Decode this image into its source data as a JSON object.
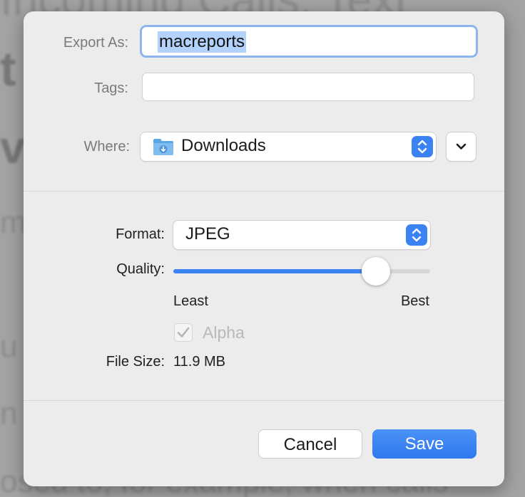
{
  "background": {
    "lines": [
      "Incoming Calls, Text",
      "t ?",
      "v",
      "m",
      "u  bl",
      "n c",
      "osed to, for example, when calls"
    ]
  },
  "dialog": {
    "export_as": {
      "label": "Export As:",
      "value": "macreports"
    },
    "tags": {
      "label": "Tags:",
      "value": ""
    },
    "where": {
      "label": "Where:",
      "value": "Downloads"
    },
    "format": {
      "label": "Format:",
      "value": "JPEG"
    },
    "quality": {
      "label": "Quality:",
      "level": 0.79,
      "min_label": "Least",
      "max_label": "Best"
    },
    "alpha": {
      "label": "Alpha",
      "checked": true,
      "enabled": false
    },
    "file_size": {
      "label": "File Size:",
      "value": "11.9 MB"
    },
    "buttons": {
      "cancel": "Cancel",
      "save": "Save"
    }
  },
  "colors": {
    "accent": "#3b83f2",
    "selection": "#b3d2fb",
    "focus_ring": "#8db4ee",
    "sheet_bg": "#ececec"
  },
  "icons": {
    "where": "folder-downloads-icon",
    "popup_arrows": "up-down-chevron-icon",
    "expand": "chevron-down-icon",
    "checkmark": "checkmark-icon"
  }
}
